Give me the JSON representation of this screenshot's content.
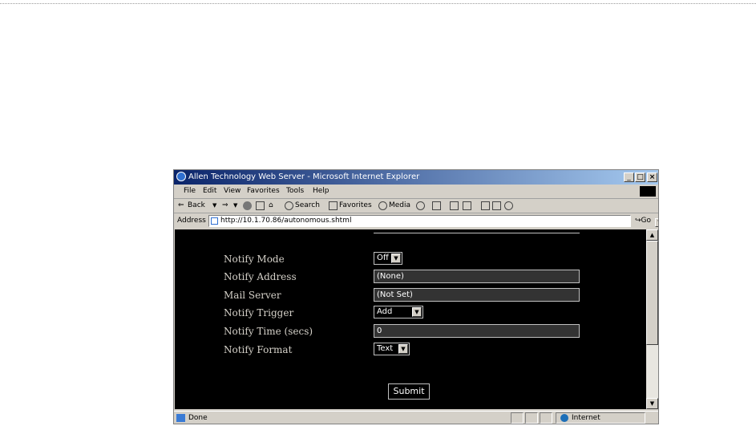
{
  "window": {
    "title": "Allen Technology Web Server - Microsoft Internet Explorer",
    "min": "_",
    "max": "□",
    "close": "×"
  },
  "menu": [
    "File",
    "Edit",
    "View",
    "Favorites",
    "Tools",
    "Help"
  ],
  "toolbar": {
    "back": "Back",
    "search": "Search",
    "favorites": "Favorites",
    "media": "Media"
  },
  "address": {
    "label": "Address",
    "url": "http://10.1.70.86/autonomous.shtml",
    "go": "Go"
  },
  "form": {
    "rows": [
      {
        "label": "Notify Mode",
        "type": "select",
        "value": "Off"
      },
      {
        "label": "Notify Address",
        "type": "text",
        "value": "(None)"
      },
      {
        "label": "Mail Server",
        "type": "text",
        "value": "(Not Set)"
      },
      {
        "label": "Notify Trigger",
        "type": "select",
        "value": "Add"
      },
      {
        "label": "Notify Time (secs)",
        "type": "text",
        "value": "0"
      },
      {
        "label": "Notify Format",
        "type": "select",
        "value": "Text"
      }
    ],
    "submit": "Submit"
  },
  "status": {
    "text": "Done",
    "zone": "Internet"
  },
  "colors": {
    "titlebar_start": "#0a246a",
    "titlebar_end": "#a6caf0",
    "content_bg": "#000000",
    "chrome": "#d4d0c8"
  }
}
